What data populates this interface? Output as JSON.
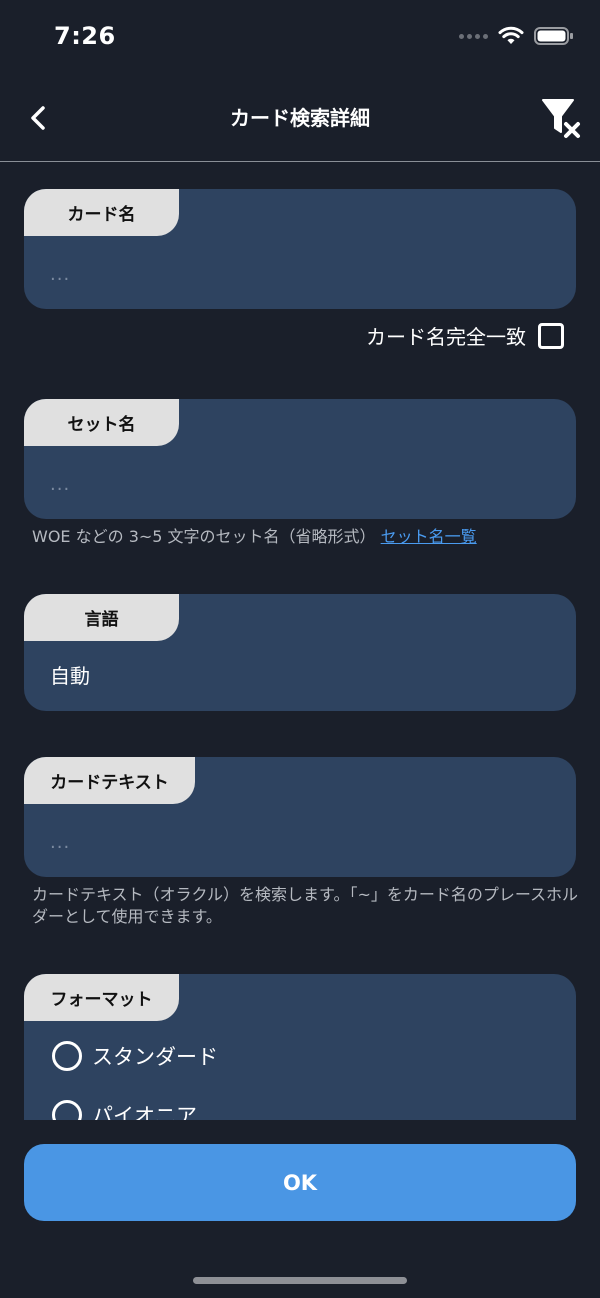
{
  "status": {
    "time": "7:26"
  },
  "nav": {
    "title": "カード検索詳細"
  },
  "fields": {
    "card_name": {
      "label": "カード名",
      "placeholder": "...",
      "exact_match_label": "カード名完全一致"
    },
    "set_name": {
      "label": "セット名",
      "placeholder": "...",
      "help_text": "WOE などの 3~5 文字のセット名（省略形式）",
      "help_link": "セット名一覧"
    },
    "language": {
      "label": "言語",
      "value": "自動"
    },
    "card_text": {
      "label": "カードテキスト",
      "placeholder": "...",
      "help_text": "カードテキスト（オラクル）を検索します。「~」をカード名のプレースホルダーとして使用できます。"
    },
    "format": {
      "label": "フォーマット",
      "options": [
        "スタンダード",
        "パイオニア"
      ]
    }
  },
  "ok_label": "OK"
}
